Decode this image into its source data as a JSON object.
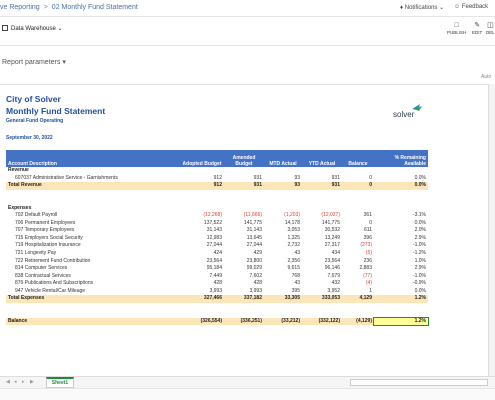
{
  "topbar": {
    "breadcrumb_parent": "ve Reporting",
    "breadcrumb_sep": ">",
    "breadcrumb_current": "02 Monthly Fund Statement",
    "notifications_label": "Notifications",
    "feedback_label": "Feedback"
  },
  "toolbar": {
    "datasource_label": "Data Warehouse",
    "actions": [
      {
        "label": "PUBLISH",
        "icon": "document-icon"
      },
      {
        "label": "EDIT",
        "icon": "pencil-icon"
      },
      {
        "label": "DEL",
        "icon": "trash-icon"
      }
    ]
  },
  "params": {
    "label": "Report parameters",
    "auto_label": "Auto"
  },
  "report": {
    "org": "City of Solver",
    "title": "Monthly Fund Statement",
    "subtitle": "General Fund Operating",
    "date": "September 30, 2022",
    "logo_text": "solver"
  },
  "table": {
    "headers": [
      "Account  Description",
      "Adopted Budget",
      "Amended Budget",
      "MTD Actual",
      "YTD Actual",
      "Balance",
      "% Remaining Available"
    ],
    "revenue_section": "Revenue",
    "revenue_rows": [
      [
        "607037 Administrative Service - Garnishments",
        "912",
        "931",
        "93",
        "931",
        "0",
        "0.0%"
      ]
    ],
    "total_revenue": [
      "Total Revenue",
      "912",
      "931",
      "93",
      "931",
      "0",
      "0.0%"
    ],
    "expenses_section": "Expenses",
    "expense_rows": [
      [
        "702 Default Payroll",
        "(12,268)",
        "(11,666)",
        "(1,203)",
        "(12,027)",
        "361",
        "-3.1%"
      ],
      [
        "706 Permanent Employees",
        "137,522",
        "141,775",
        "14,178",
        "141,775",
        "0",
        "0.0%"
      ],
      [
        "707 Temporary Employees",
        "31,143",
        "31,143",
        "3,053",
        "30,532",
        "611",
        "2.0%"
      ],
      [
        "715 Employers Social Security",
        "12,983",
        "13,645",
        "1,325",
        "13,249",
        "396",
        "2.9%"
      ],
      [
        "719 Hospitalization Insurance",
        "27,044",
        "27,044",
        "2,732",
        "27,317",
        "(273)",
        "-1.0%"
      ],
      [
        "721 Longevity Pay",
        "424",
        "429",
        "43",
        "434",
        "(5)",
        "-1.2%"
      ],
      [
        "722 Retirement Fund Contribution",
        "23,564",
        "23,800",
        "2,356",
        "23,564",
        "236",
        "1.0%"
      ],
      [
        "814 Computer Services",
        "95,184",
        "99,029",
        "9,615",
        "96,146",
        "2,883",
        "2.9%"
      ],
      [
        "838 Contractual Services",
        "7,449",
        "7,602",
        "768",
        "7,679",
        "(77)",
        "-1.0%"
      ],
      [
        "876 Publications And Subscriptions",
        "428",
        "428",
        "43",
        "432",
        "(4)",
        "-0.9%"
      ],
      [
        "947 Vehicle Rental/Car Mileage",
        "3,993",
        "3,993",
        "395",
        "3,952",
        "1",
        "0.0%"
      ]
    ],
    "total_expenses": [
      "Total Expenses",
      "327,466",
      "337,182",
      "33,305",
      "333,053",
      "4,129",
      "1.2%"
    ],
    "balance_row": [
      "Balance",
      "(326,554)",
      "(336,251)",
      "(33,212)",
      "(332,122)",
      "(4,129)",
      "1.2%"
    ],
    "negative_color": "#e03c31",
    "header_color": "#4472c4",
    "total_color": "#fce5b8"
  },
  "footer": {
    "sheet_tab": "Sheet1"
  }
}
